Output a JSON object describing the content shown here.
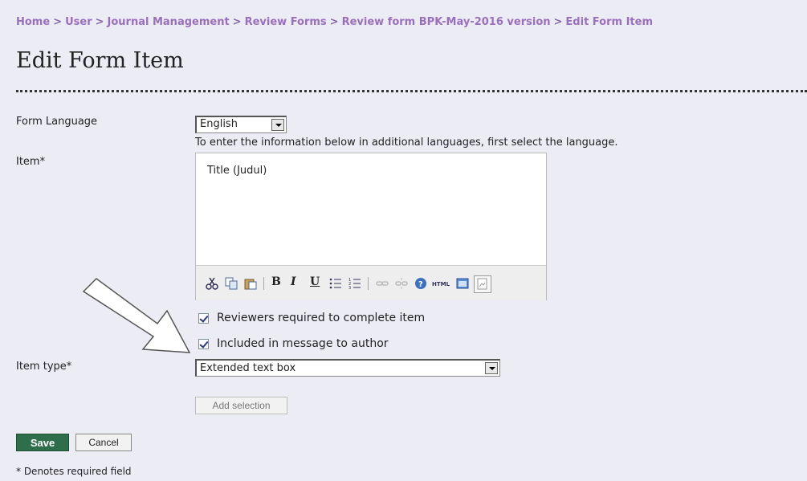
{
  "breadcrumb": {
    "items": [
      "Home",
      "User",
      "Journal Management",
      "Review Forms",
      "Review form BPK-May-2016 version"
    ],
    "current": "Edit Form Item",
    "separator": ">"
  },
  "page_title": "Edit Form Item",
  "form": {
    "language_label": "Form Language",
    "language_value": "English",
    "language_hint": "To enter the information below in additional languages, first select the language.",
    "item_label": "Item*",
    "item_value": "Title (Judul)",
    "toolbar": {
      "icons": [
        "cut-icon",
        "copy-icon",
        "paste-icon",
        "bold-icon",
        "italic-icon",
        "underline-icon",
        "bullet-list-icon",
        "numbered-list-icon",
        "link-icon",
        "unlink-icon",
        "help-icon",
        "html-icon",
        "fullscreen-icon",
        "image-icon"
      ],
      "bold": "B",
      "italic": "I",
      "underline": "U"
    },
    "checkbox_required": "Reviewers required to complete item",
    "checkbox_included": "Included in message to author",
    "item_type_label": "Item type*",
    "item_type_value": "Extended text box",
    "add_selection": "Add selection",
    "save": "Save",
    "cancel": "Cancel"
  },
  "footnote": "* Denotes required field"
}
